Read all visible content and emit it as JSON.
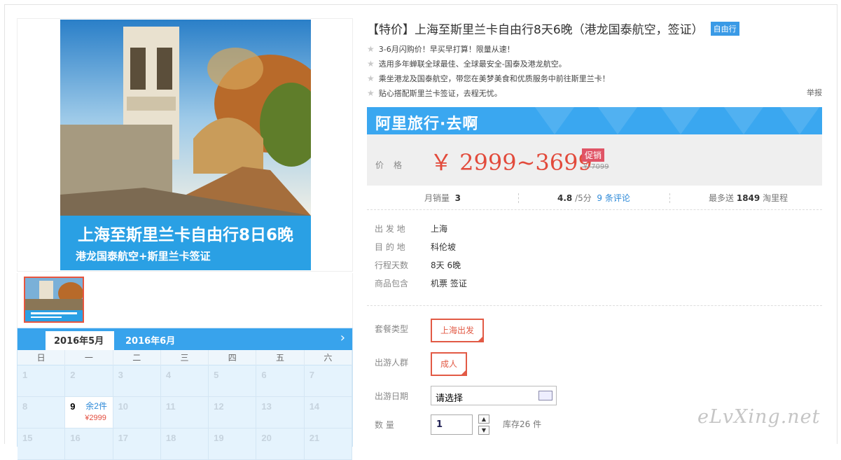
{
  "product": {
    "title": "【特价】上海至斯里兰卡自由行8天6晚（港龙国泰航空，签证）",
    "tag": "自由行",
    "features": [
      "3-6月闪购价！早买早打算！限量从速！",
      "选用多年蝉联全球最佳、全球最安全-国泰及港龙航空。",
      "乘坐港龙及国泰航空，带您在美梦美食和优质服务中前往斯里兰卡！",
      "贴心搭配斯里兰卡签证，去程无忧。"
    ],
    "report": "举报",
    "image_caption_main": "上海至斯里兰卡自由行8日6晚",
    "image_caption_sub": "港龙国泰航空+斯里兰卡签证"
  },
  "banner": {
    "brand": "阿里旅行·去啊",
    "price_label": "价格",
    "price": "￥ 2999~3699",
    "promo": "促销",
    "original_price": "￥ 7099"
  },
  "stats": {
    "sales_label": "月销量",
    "sales_value": "3",
    "rating_value": "4.8",
    "rating_scale": "/5分",
    "reviews": "9 条评论",
    "points_prefix": "最多送",
    "points_value": "1849",
    "points_suffix": "淘里程"
  },
  "info": [
    {
      "key": "出 发 地",
      "value": "上海"
    },
    {
      "key": "目 的 地",
      "value": "科伦坡"
    },
    {
      "key": "行程天数",
      "value": "8天 6晚"
    },
    {
      "key": "商品包含",
      "value": "机票  签证"
    }
  ],
  "options": {
    "package_label": "套餐类型",
    "package_value": "上海出发",
    "crowd_label": "出游人群",
    "crowd_value": "成人",
    "date_label": "出游日期",
    "date_placeholder": "请选择",
    "qty_label": "数    量",
    "qty_value": "1",
    "stock": "库存26 件"
  },
  "calendar": {
    "tabs": [
      "2016年5月",
      "2016年6月"
    ],
    "weekdays": [
      "日",
      "一",
      "二",
      "三",
      "四",
      "五",
      "六"
    ],
    "rows": [
      [
        "1",
        "2",
        "3",
        "4",
        "5",
        "6",
        "7"
      ],
      [
        "8",
        "9",
        "10",
        "11",
        "12",
        "13",
        "14"
      ],
      [
        "15",
        "16",
        "17",
        "18",
        "19",
        "20",
        "21"
      ]
    ],
    "available_day": "9",
    "available_remaining": "余2件",
    "available_price": "¥2999"
  },
  "watermark": "eLvXing.net",
  "colors": {
    "accent": "#38a3ec",
    "price": "#e24a3b",
    "selected": "#e25a45"
  }
}
